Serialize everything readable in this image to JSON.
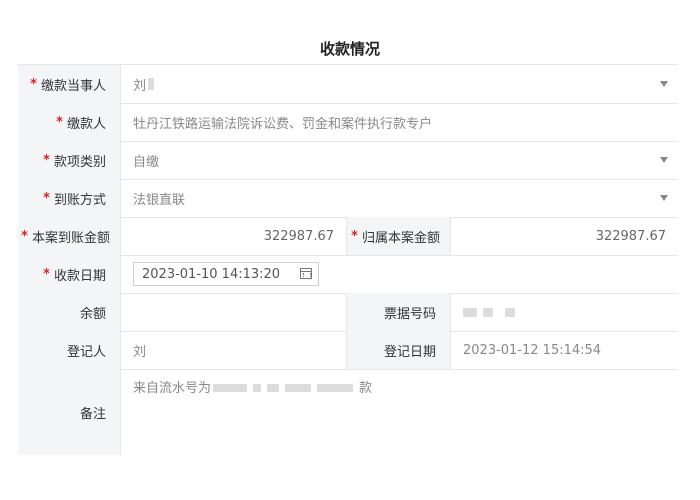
{
  "title": "收款情况",
  "fields": {
    "payer": {
      "label": "缴款当事人",
      "required": true,
      "value": "刘"
    },
    "payee": {
      "label": "缴款人",
      "required": true,
      "value": "牡丹江铁路运输法院诉讼费、罚金和案件执行款专户"
    },
    "category": {
      "label": "款项类别",
      "required": true,
      "value": "自缴"
    },
    "method": {
      "label": "到账方式",
      "required": true,
      "value": "法银直联"
    },
    "case_amount": {
      "label": "本案到账金额",
      "required": true,
      "value": "322987.67"
    },
    "attributed_amount": {
      "label": "归属本案金额",
      "required": true,
      "value": "322987.67"
    },
    "receipt_date": {
      "label": "收款日期",
      "required": true,
      "value": "2023-01-10 14:13:20"
    },
    "balance": {
      "label": "余额",
      "required": false,
      "value": ""
    },
    "invoice_no": {
      "label": "票据号码",
      "required": false,
      "value": ""
    },
    "registrar": {
      "label": "登记人",
      "required": false,
      "value": "刘"
    },
    "register_date": {
      "label": "登记日期",
      "required": false,
      "value": "2023-01-12 15:14:54"
    },
    "remark": {
      "label": "备注",
      "required": false,
      "prefix": "来自流水号为",
      "suffix": "款"
    }
  },
  "colors": {
    "required_star": "#e02020",
    "label_bg": "#f4f5f7",
    "border": "#e6e6e6"
  }
}
